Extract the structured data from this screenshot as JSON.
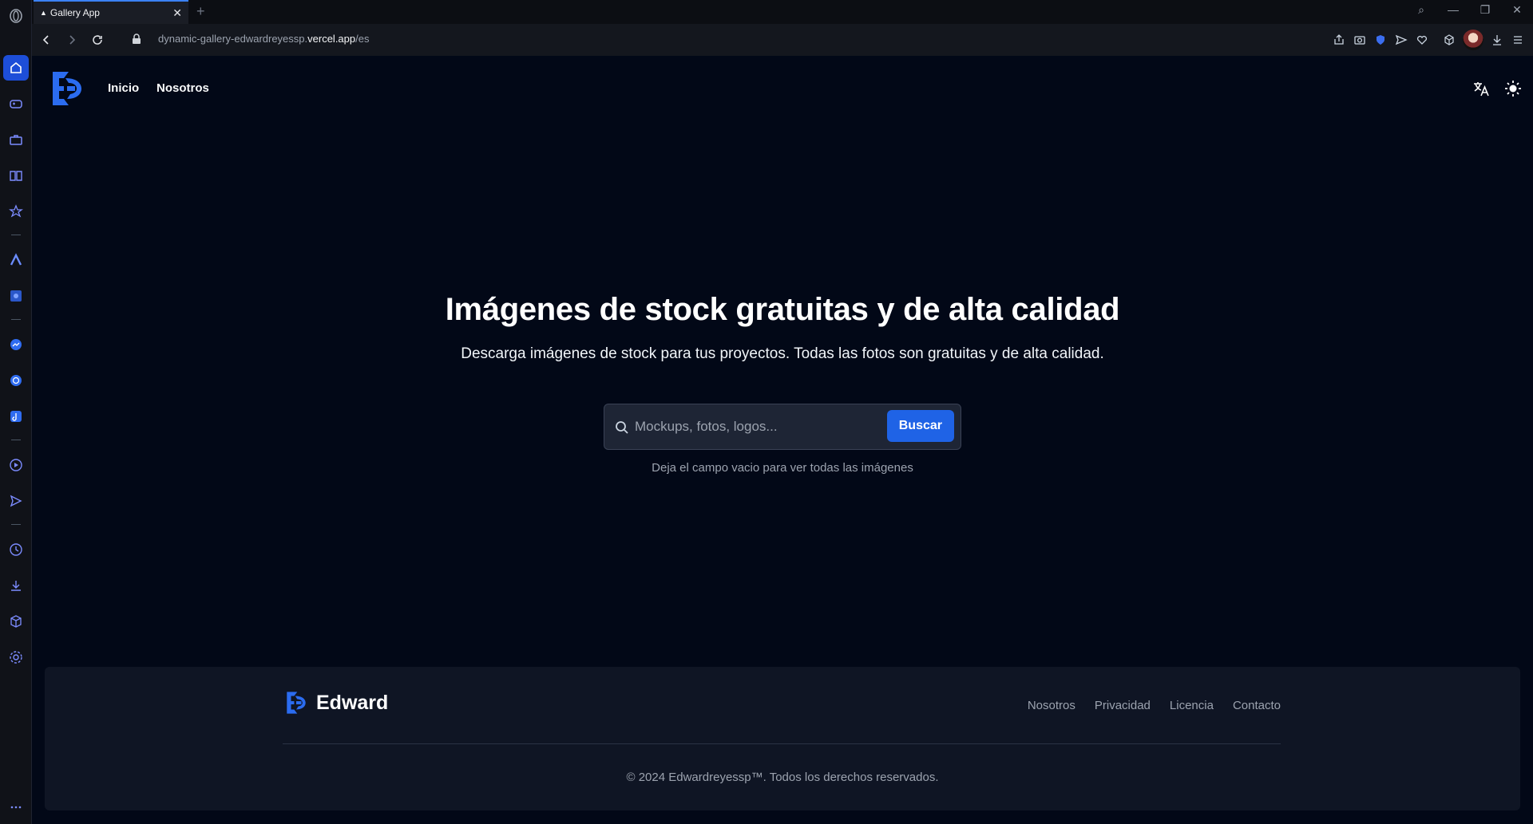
{
  "browser": {
    "tab_title": "Gallery App",
    "url_prefix": "dynamic-gallery-edwardreyessp.",
    "url_domain": "vercel.app",
    "url_path": "/es"
  },
  "nav": {
    "links": [
      "Inicio",
      "Nosotros"
    ]
  },
  "hero": {
    "title": "Imágenes de stock gratuitas y de alta calidad",
    "subtitle": "Descarga imágenes de stock para tus proyectos. Todas las fotos son gratuitas y de alta calidad."
  },
  "search": {
    "placeholder": "Mockups, fotos, logos...",
    "button_label": "Buscar",
    "hint": "Deja el campo vacio para ver todas las imágenes"
  },
  "footer": {
    "brand": "Edward",
    "links": [
      "Nosotros",
      "Privacidad",
      "Licencia",
      "Contacto"
    ],
    "copyright": "© 2024 Edwardreyessp™. Todos los derechos reservados."
  },
  "colors": {
    "background": "#020817",
    "accent": "#1f63e6",
    "footer_bg": "#0f1524"
  }
}
